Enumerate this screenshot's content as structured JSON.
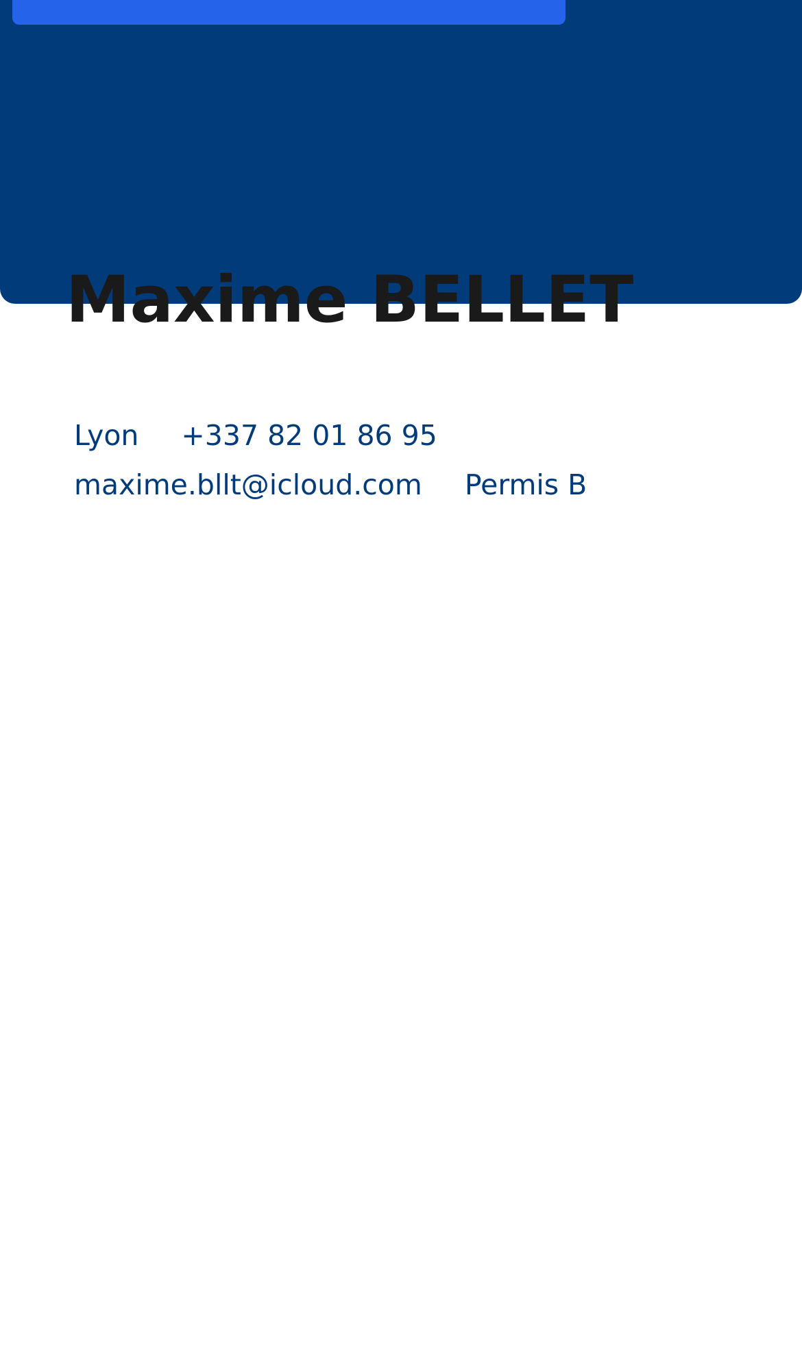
{
  "colors": {
    "header_background": "#023b79",
    "accent_bar": "#2563eb",
    "name_text": "#1a1a1a",
    "contact_text": "#023b79",
    "page_background": "#ffffff"
  },
  "profile": {
    "name": "Maxime BELLET"
  },
  "contact": {
    "city": "Lyon",
    "phone": "+337 82 01 86 95",
    "email": "maxime.bllt@icloud.com",
    "license": "Permis B"
  }
}
